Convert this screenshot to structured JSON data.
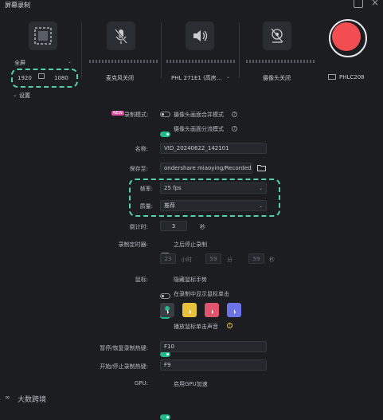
{
  "window": {
    "title": "屏幕录制"
  },
  "devices": {
    "screen_mode": "全屏",
    "width": "1920",
    "height": "1080",
    "mic_label": "麦克风关闭",
    "speaker_label": "PHL 271E1 (高房...",
    "camera_label": "摄像头关闭",
    "monitor_label": "PHLC208"
  },
  "settings_title": "设置",
  "record_mode": {
    "new_badge": "NEW",
    "label": "录制模式:",
    "option1": "摄像头画面合并模式",
    "option2": "摄像头画面分流模式"
  },
  "name": {
    "label": "名称:",
    "value": "VID_20240622_142101"
  },
  "save_to": {
    "label": "保存至:",
    "value": "ondershare miaoying/Recorded"
  },
  "frame_rate": {
    "label": "帧率:",
    "value": "25 fps"
  },
  "quality": {
    "label": "质量:",
    "value": "推荐"
  },
  "countdown": {
    "label": "倒计时:",
    "value": "3",
    "unit": "秒"
  },
  "timer": {
    "label": "录制定时器:",
    "toggle_text": "之后停止录制",
    "hours": "23",
    "hours_unit": "小时",
    "minutes": "59",
    "minutes_unit": "分",
    "seconds": "59",
    "seconds_unit": "秒"
  },
  "mouse": {
    "label": "鼠标:",
    "hide_cursor": "隐藏鼠标手势",
    "show_clicks": "在录制中显示鼠标单击",
    "click_sound": "播放鼠标单击声音",
    "cursor_colors": [
      "#3a3d43",
      "#e8c13b",
      "#e0556b",
      "#6d74e8"
    ]
  },
  "hotkeys": {
    "pause_label": "暂停/恢复录制热键:",
    "pause_value": "F10",
    "start_label": "开始/停止录制热键:",
    "start_value": "F9"
  },
  "gpu": {
    "label": "GPU:",
    "value": "启用GPU加速"
  },
  "watermark": "大数跨境",
  "colors": {
    "accent": "#22b88c",
    "record": "#f24e51",
    "highlight": "#54d1ac"
  }
}
